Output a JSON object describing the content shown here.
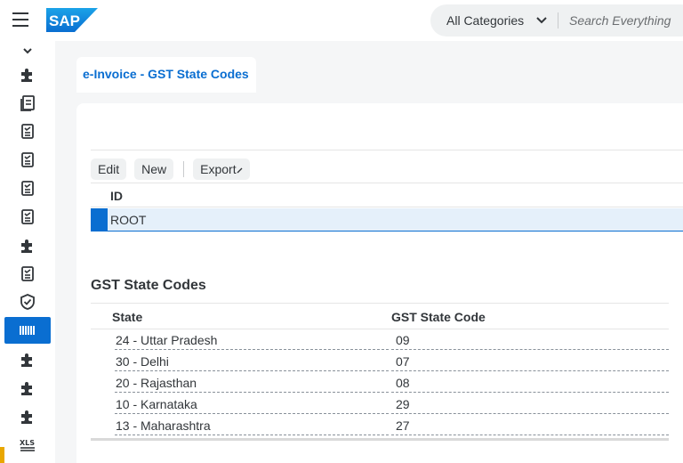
{
  "shell": {
    "logo_text": "SAP",
    "category": "All Categories",
    "search_placeholder": "Search Everything"
  },
  "leftnav": {
    "items": [
      {
        "icon": "puzzle-icon",
        "active": false
      },
      {
        "icon": "documents-icon",
        "active": false
      },
      {
        "icon": "checklist-icon",
        "active": false
      },
      {
        "icon": "checklist-icon",
        "active": false
      },
      {
        "icon": "checklist-icon",
        "active": false
      },
      {
        "icon": "checklist-icon",
        "active": false
      },
      {
        "icon": "puzzle-icon",
        "active": false
      },
      {
        "icon": "checklist-icon",
        "active": false
      },
      {
        "icon": "shield-check-icon",
        "active": false
      },
      {
        "icon": "barcode-icon",
        "active": true
      },
      {
        "icon": "puzzle-icon",
        "active": false
      },
      {
        "icon": "puzzle-icon",
        "active": false
      },
      {
        "icon": "puzzle-icon",
        "active": false
      },
      {
        "icon": "xls-icon",
        "active": false
      },
      {
        "icon": "menu-icon",
        "active": false
      }
    ]
  },
  "tab": {
    "label": "e-Invoice - GST State Codes"
  },
  "toolbar": {
    "edit": "Edit",
    "new": "New",
    "export": "Export"
  },
  "id_table": {
    "header": "ID",
    "rows": [
      "ROOT"
    ]
  },
  "gst": {
    "title": "GST State Codes",
    "columns": [
      "State",
      "GST State Code"
    ],
    "rows": [
      {
        "state": "24 - Uttar Pradesh",
        "code": "09"
      },
      {
        "state": "30 - Delhi",
        "code": "07"
      },
      {
        "state": "20 - Rajasthan",
        "code": "08"
      },
      {
        "state": "10 - Karnataka",
        "code": "29"
      },
      {
        "state": "13 - Maharashtra",
        "code": "27"
      }
    ]
  },
  "colors": {
    "accent": "#0a6ed1",
    "selection_bg": "#e5f0fa",
    "scroll_marker": "#e9a700"
  }
}
